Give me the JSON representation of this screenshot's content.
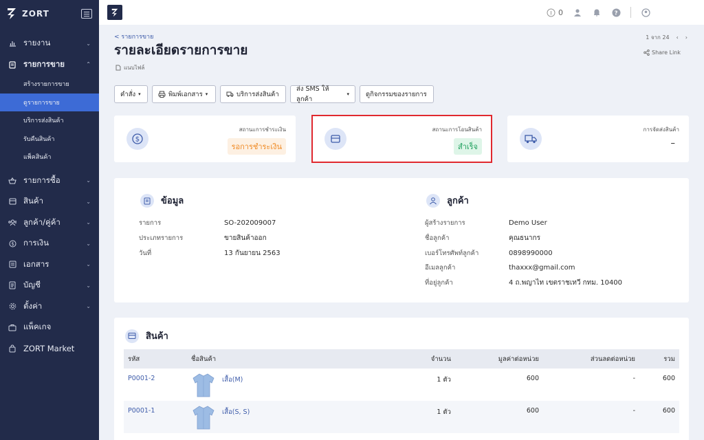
{
  "brand": {
    "name": "ZORT"
  },
  "sidebar": {
    "items": [
      {
        "label": "รายงาน",
        "icon": "bar-chart-icon"
      },
      {
        "label": "รายการขาย",
        "icon": "clipboard-icon"
      },
      {
        "label": "รายการซื้อ",
        "icon": "basket-icon"
      },
      {
        "label": "สินค้า",
        "icon": "box-icon"
      },
      {
        "label": "ลูกค้า/คู่ค้า",
        "icon": "users-icon"
      },
      {
        "label": "การเงิน",
        "icon": "dollar-icon"
      },
      {
        "label": "เอกสาร",
        "icon": "document-icon"
      },
      {
        "label": "บัญชี",
        "icon": "ledger-icon"
      },
      {
        "label": "ตั้งค่า",
        "icon": "gear-icon"
      },
      {
        "label": "แพ็คเกจ",
        "icon": "package-icon"
      },
      {
        "label": "ZORT Market",
        "icon": "shopping-bag-icon"
      }
    ],
    "sub_items": [
      {
        "label": "สร้างรายการขาย"
      },
      {
        "label": "ดูรายการขาย"
      },
      {
        "label": "บริการส่งสินค้า"
      },
      {
        "label": "รับคืนสินค้า"
      },
      {
        "label": "แพ็คสินค้า"
      }
    ]
  },
  "topbar": {
    "counter": "0"
  },
  "header": {
    "breadcrumb": "< รายการขาย",
    "title": "รายละเอียดรายการขาย",
    "attachment": "แนบไฟล์",
    "pager": "1 จาก 24",
    "share": "Share Link"
  },
  "toolbar": {
    "command": "คำสั่ง",
    "print": "พิมพ์เอกสาร",
    "shipping": "บริการส่งสินค้า",
    "sms": "ส่ง SMS ให้ลูกค้า",
    "activity": "ดูกิจกรรมของรายการ"
  },
  "status": {
    "payment": {
      "label": "สถานะการชำระเงิน",
      "value": "รอการชำระเงิน",
      "color": "#f08a24",
      "bg": "#fdf0e2"
    },
    "transfer": {
      "label": "สถานะการโอนสินค้า",
      "value": "สำเร็จ",
      "color": "#1b9e5a",
      "bg": "#def5e8"
    },
    "delivery": {
      "label": "การจัดส่งสินค้า",
      "value": "–"
    }
  },
  "info": {
    "title": "ข้อมูล",
    "rows": [
      {
        "k": "รายการ",
        "v": "SO-202009007"
      },
      {
        "k": "ประเภทรายการ",
        "v": "ขายสินค้าออก"
      },
      {
        "k": "วันที่",
        "v": "13 กันยายน 2563"
      }
    ]
  },
  "customer": {
    "title": "ลูกค้า",
    "rows": [
      {
        "k": "ผู้สร้างรายการ",
        "v": "Demo User"
      },
      {
        "k": "ชื่อลูกค้า",
        "v": "คุณธนากร"
      },
      {
        "k": "เบอร์โทรศัพท์ลูกค้า",
        "v": "0898990000"
      },
      {
        "k": "อีเมลลูกค้า",
        "v": "thaxxx@gmail.com"
      },
      {
        "k": "ที่อยู่ลูกค้า",
        "v": "4 ถ.พญาไท เขตราชเทวี กทม. 10400"
      }
    ]
  },
  "products": {
    "title": "สินค้า",
    "columns": [
      "รหัส",
      "ชื่อสินค้า",
      "จำนวน",
      "มูลค่าต่อหน่วย",
      "ส่วนลดต่อหน่วย",
      "รวม"
    ],
    "rows": [
      {
        "code": "P0001-2",
        "name": "เสื้อ(M)",
        "qty": "1 ตัว",
        "unit": "600",
        "discount": "-",
        "total": "600"
      },
      {
        "code": "P0001-1",
        "name": "เสื้อ(S, S)",
        "qty": "1 ตัว",
        "unit": "600",
        "discount": "-",
        "total": "600"
      }
    ]
  }
}
